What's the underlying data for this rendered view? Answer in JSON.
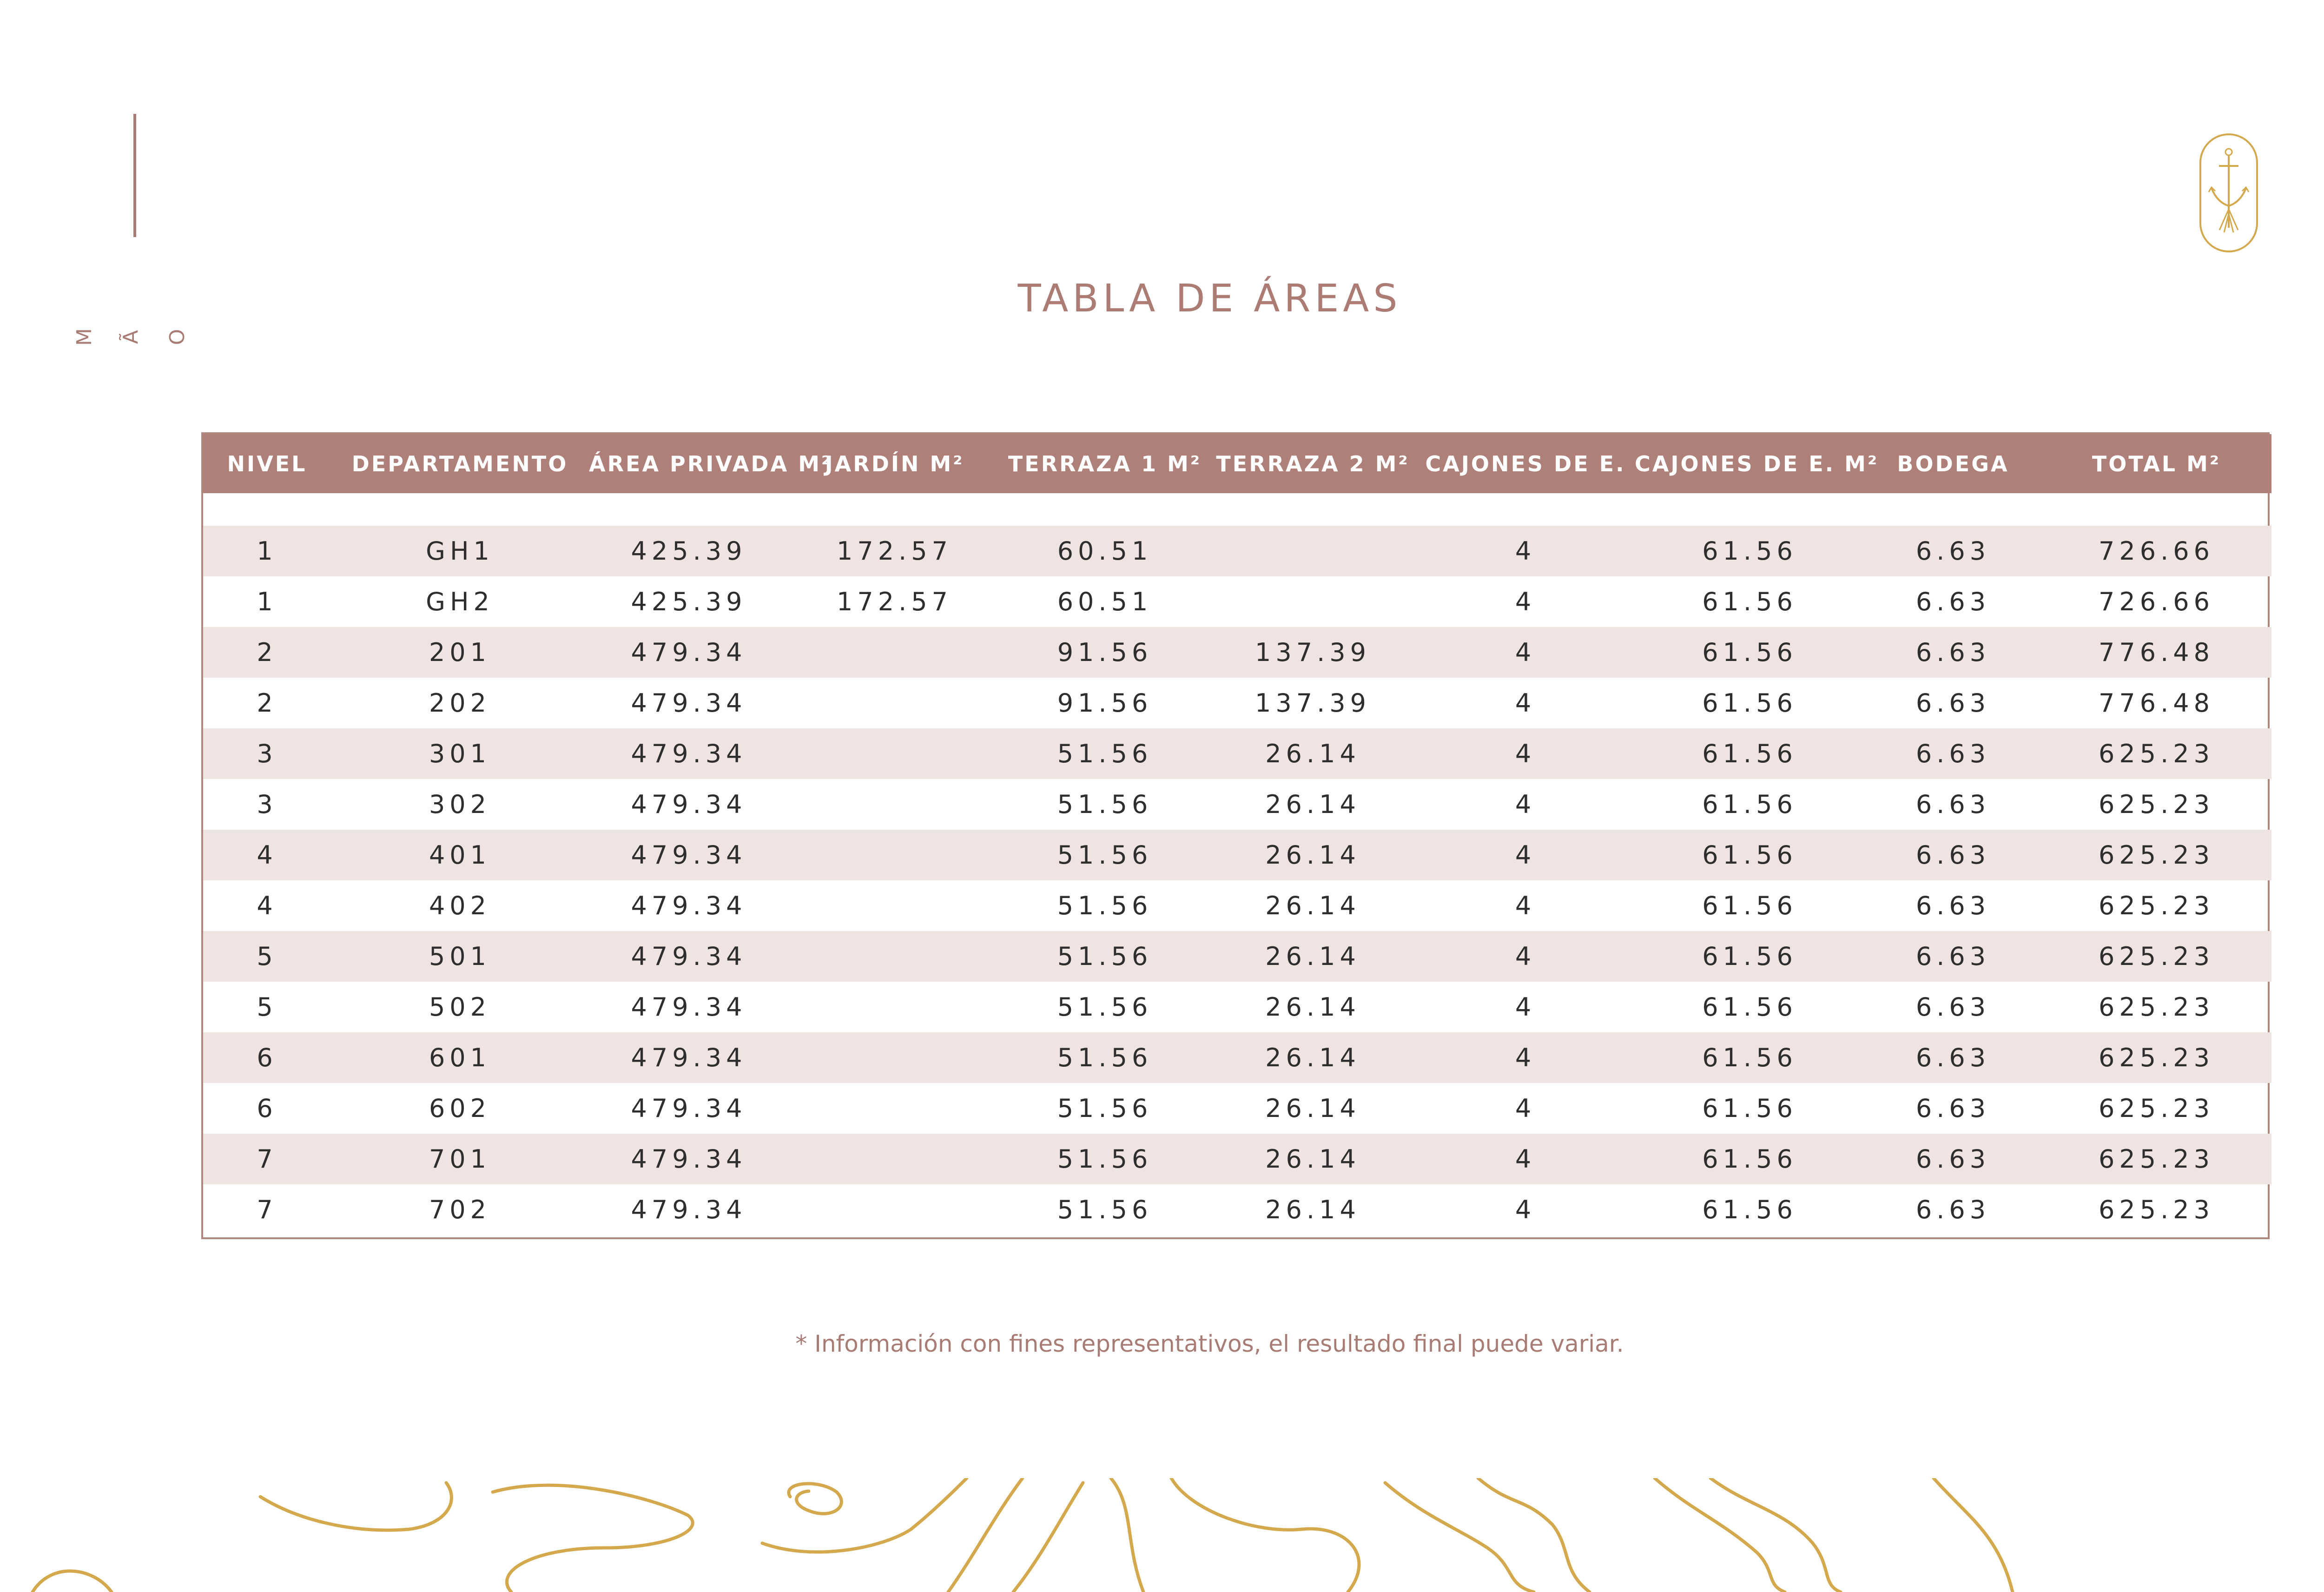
{
  "brand": {
    "side_text": "M Ã O"
  },
  "title": "TABLA DE ÁREAS",
  "table": {
    "headers": [
      "NIVEL",
      "DEPARTAMENTO",
      "ÁREA PRIVADA M²",
      "JARDÍN M²",
      "TERRAZA 1 M²",
      "TERRAZA 2 M²",
      "CAJONES DE E.",
      "CAJONES DE E. M²",
      "BODEGA",
      "TOTAL M²"
    ],
    "rows": [
      [
        "1",
        "GH1",
        "425.39",
        "172.57",
        "60.51",
        "",
        "4",
        "61.56",
        "6.63",
        "726.66"
      ],
      [
        "1",
        "GH2",
        "425.39",
        "172.57",
        "60.51",
        "",
        "4",
        "61.56",
        "6.63",
        "726.66"
      ],
      [
        "2",
        "201",
        "479.34",
        "",
        "91.56",
        "137.39",
        "4",
        "61.56",
        "6.63",
        "776.48"
      ],
      [
        "2",
        "202",
        "479.34",
        "",
        "91.56",
        "137.39",
        "4",
        "61.56",
        "6.63",
        "776.48"
      ],
      [
        "3",
        "301",
        "479.34",
        "",
        "51.56",
        "26.14",
        "4",
        "61.56",
        "6.63",
        "625.23"
      ],
      [
        "3",
        "302",
        "479.34",
        "",
        "51.56",
        "26.14",
        "4",
        "61.56",
        "6.63",
        "625.23"
      ],
      [
        "4",
        "401",
        "479.34",
        "",
        "51.56",
        "26.14",
        "4",
        "61.56",
        "6.63",
        "625.23"
      ],
      [
        "4",
        "402",
        "479.34",
        "",
        "51.56",
        "26.14",
        "4",
        "61.56",
        "6.63",
        "625.23"
      ],
      [
        "5",
        "501",
        "479.34",
        "",
        "51.56",
        "26.14",
        "4",
        "61.56",
        "6.63",
        "625.23"
      ],
      [
        "5",
        "502",
        "479.34",
        "",
        "51.56",
        "26.14",
        "4",
        "61.56",
        "6.63",
        "625.23"
      ],
      [
        "6",
        "601",
        "479.34",
        "",
        "51.56",
        "26.14",
        "4",
        "61.56",
        "6.63",
        "625.23"
      ],
      [
        "6",
        "602",
        "479.34",
        "",
        "51.56",
        "26.14",
        "4",
        "61.56",
        "6.63",
        "625.23"
      ],
      [
        "7",
        "701",
        "479.34",
        "",
        "51.56",
        "26.14",
        "4",
        "61.56",
        "6.63",
        "625.23"
      ],
      [
        "7",
        "702",
        "479.34",
        "",
        "51.56",
        "26.14",
        "4",
        "61.56",
        "6.63",
        "625.23"
      ]
    ]
  },
  "footnote": "* Información con fines representativos, el resultado final puede variar.",
  "colors": {
    "accent": "#ae8079",
    "row_stripe": "#efe4e2",
    "gold": "#d4a94e"
  },
  "icons": [
    "anchor-logo-icon",
    "topographic-lines-decoration"
  ]
}
